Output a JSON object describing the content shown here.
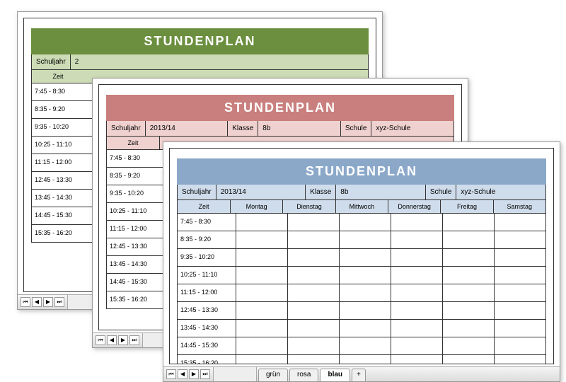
{
  "title": "STUNDENPLAN",
  "meta": {
    "schuljahr_label": "Schuljahr",
    "schuljahr_value": "2013/14",
    "klasse_label": "Klasse",
    "klasse_value": "8b",
    "schule_label": "Schule",
    "schule_value": "xyz-Schule"
  },
  "columns": {
    "time": "Zeit",
    "days": [
      "Montag",
      "Dienstag",
      "Mittwoch",
      "Donnerstag",
      "Freitag",
      "Samstag"
    ]
  },
  "times": [
    "7:45 - 8:30",
    "8:35 - 9:20",
    "9:35 - 10:20",
    "10:25 - 11:10",
    "11:15 - 12:00",
    "12:45 - 13:30",
    "13:45 - 14:30",
    "14:45 - 15:30",
    "15:35 - 16:20"
  ],
  "tabs": {
    "gruen": "grün",
    "rosa": "rosa",
    "blau": "blau",
    "add": "+"
  },
  "nav": {
    "first": "⏮",
    "prev": "◀",
    "next": "▶",
    "last": "⏭"
  },
  "short_schuljahr": "2"
}
